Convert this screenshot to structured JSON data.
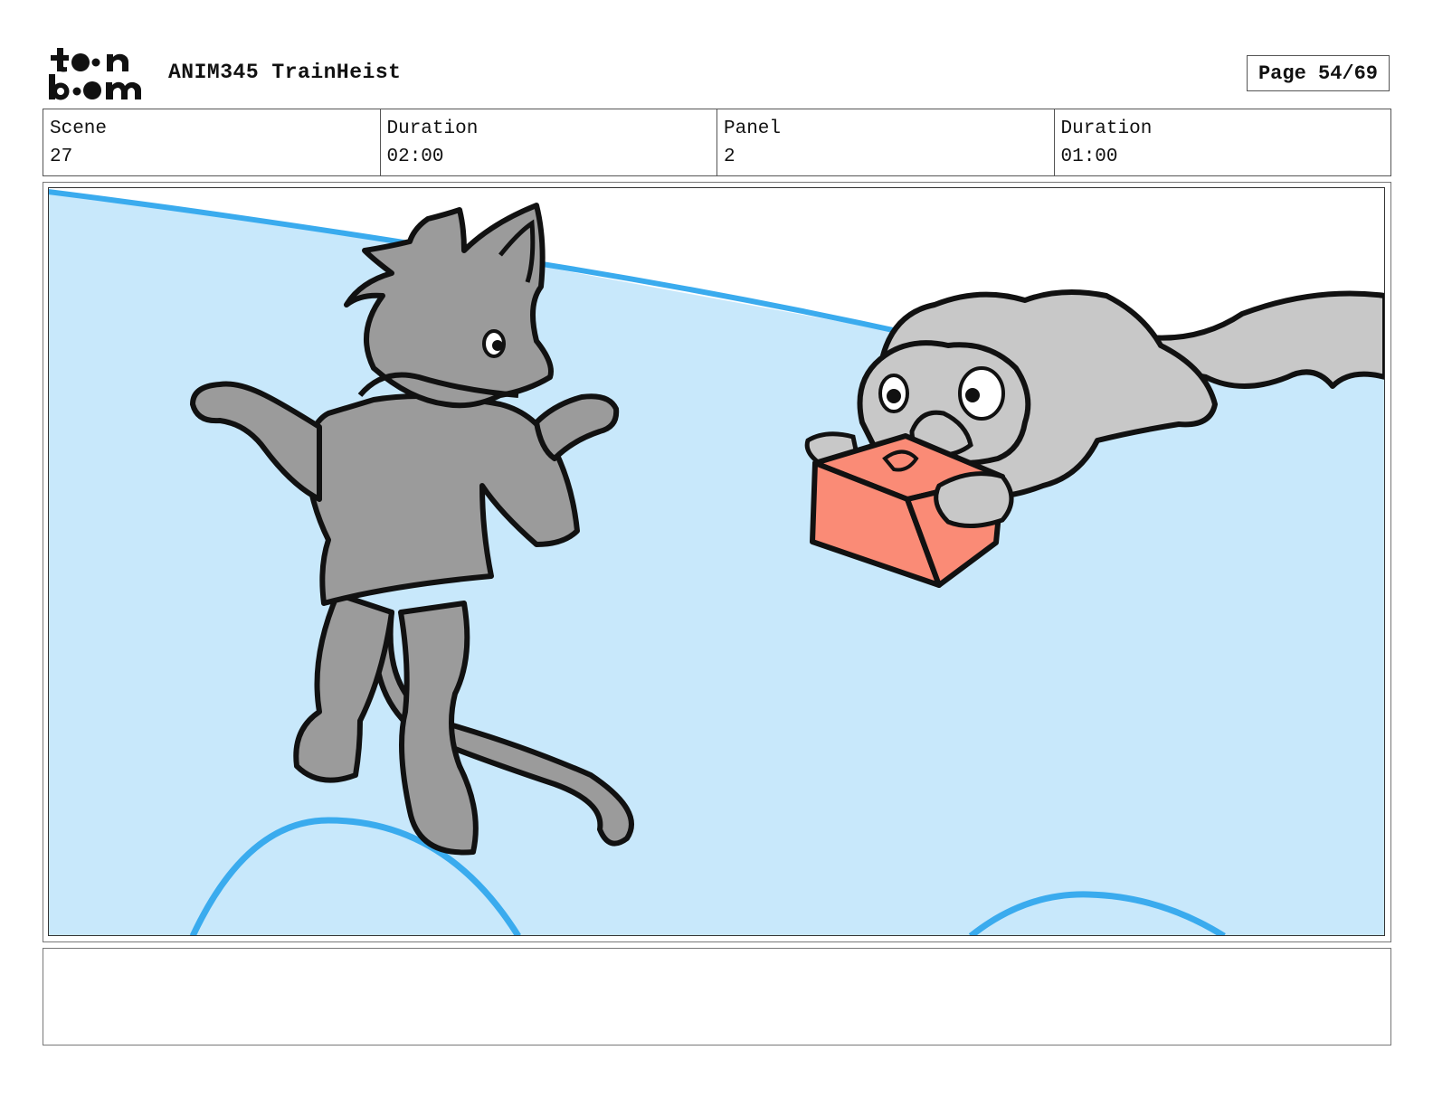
{
  "header": {
    "logo_text": "toon boom",
    "project_title": "ANIM345 TrainHeist",
    "page_indicator": "Page 54/69"
  },
  "info": {
    "scene": {
      "label": "Scene",
      "value": "27"
    },
    "scene_duration": {
      "label": "Duration",
      "value": "02:00"
    },
    "panel": {
      "label": "Panel",
      "value": "2"
    },
    "panel_duration": {
      "label": "Duration",
      "value": "01:00"
    }
  },
  "panel_image": {
    "description_colors": {
      "sky": "#c8e8fb",
      "line_blue": "#3aabee",
      "dark_cat": "#9b9b9b",
      "light_cat": "#c8c8c8",
      "box": "#fa8b76"
    }
  },
  "notes": {
    "text": ""
  }
}
